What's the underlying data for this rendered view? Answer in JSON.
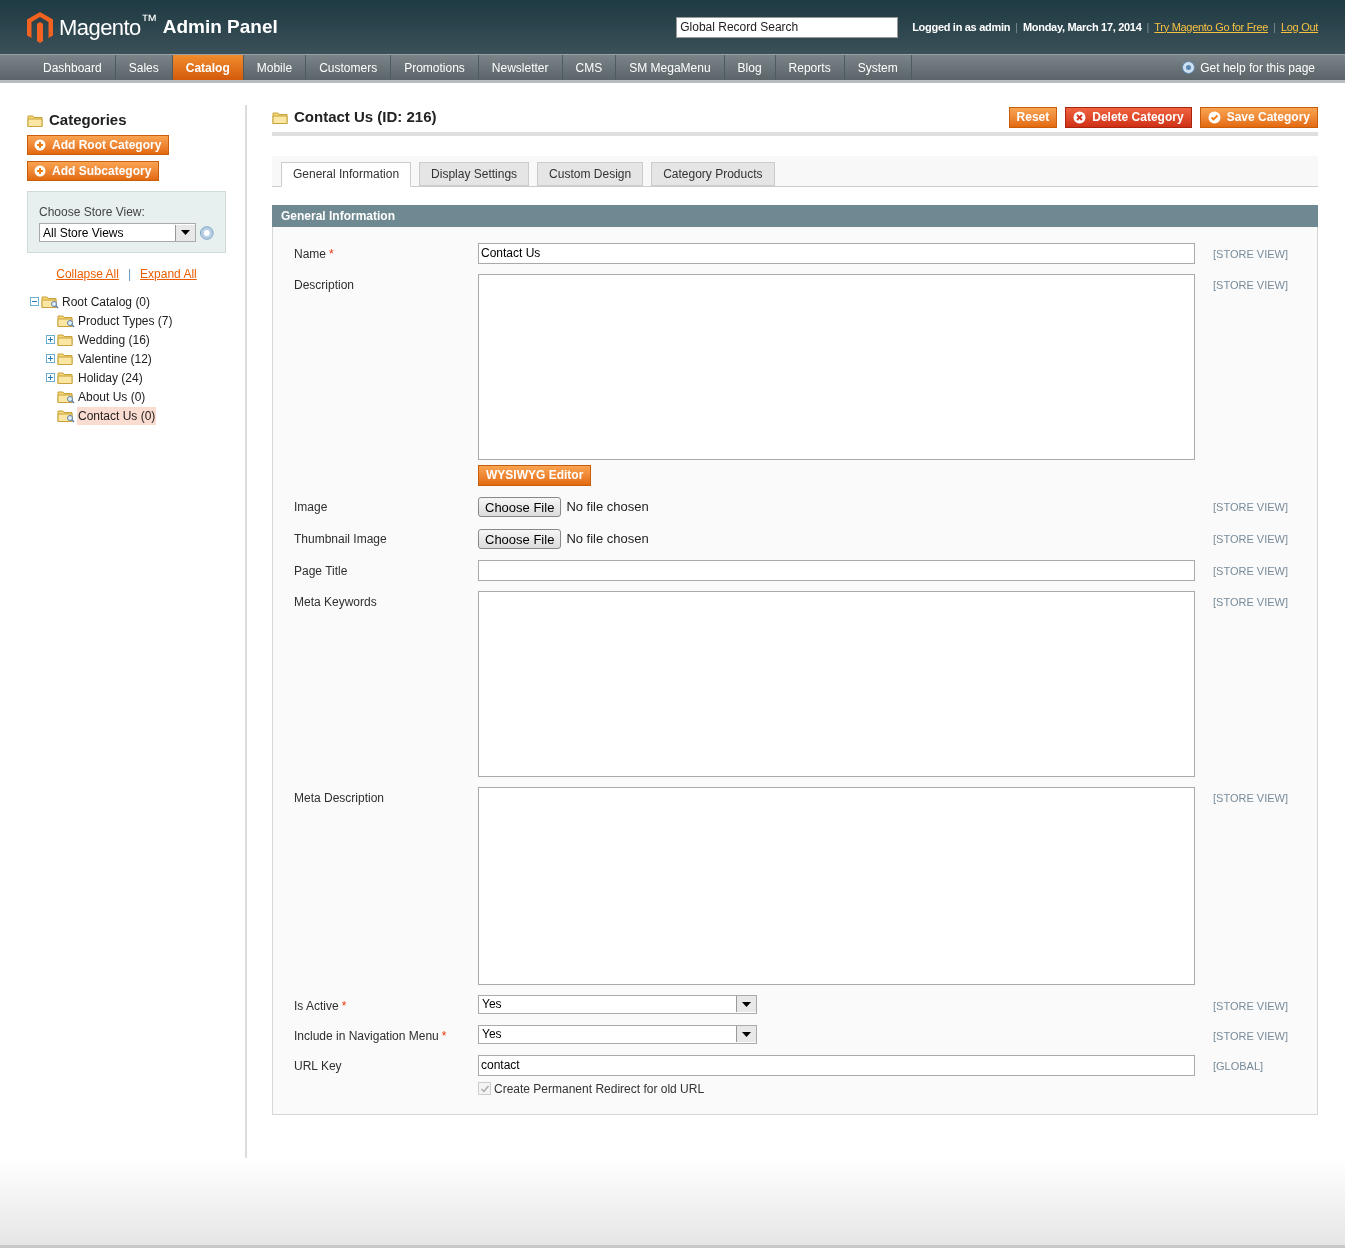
{
  "header": {
    "logo": "Magento$^{™}$",
    "logo_suffix": "Admin Panel",
    "search": {
      "placeholder": "Global Record Search"
    },
    "user": "Logged in as admin",
    "date": "Monday, March 17, 2014",
    "links": [
      "Try Magento Go for Free",
      "Log Out"
    ],
    "separator": "|"
  },
  "nav": {
    "items": [
      {
        "label": "Dashboard",
        "selected": false
      },
      {
        "label": "Sales",
        "selected": false
      },
      {
        "label": "Catalog",
        "selected": true
      },
      {
        "label": "Mobile",
        "selected": false
      },
      {
        "label": "Customers",
        "selected": false
      },
      {
        "label": "Promotions",
        "selected": false
      },
      {
        "label": "Newsletter",
        "selected": false
      },
      {
        "label": "CMS",
        "selected": false
      },
      {
        "label": "SM MegaMenu",
        "selected": false
      },
      {
        "label": "Blog",
        "selected": false
      },
      {
        "label": "Reports",
        "selected": false
      },
      {
        "label": "System",
        "selected": false
      }
    ],
    "help": "Get help for this page"
  },
  "sidebar": {
    "title": "Categories",
    "buttons": [
      "Add Root Category",
      "Add Subcategory"
    ],
    "store_view": {
      "label": "Choose Store View:",
      "value": "All Store Views"
    },
    "collapse": "Collapse All",
    "separator": "|",
    "expand": "Expand All",
    "tree": [
      {
        "label": "Root Catalog (0)",
        "kind": "leaf",
        "expanded": true,
        "selected": false,
        "children": [
          {
            "label": "Product Types (7)",
            "kind": "leaf",
            "expanded": false,
            "selected": false
          },
          {
            "label": "Wedding (16)",
            "kind": "branch",
            "expanded": false,
            "selected": false
          },
          {
            "label": "Valentine (12)",
            "kind": "branch",
            "expanded": false,
            "selected": false
          },
          {
            "label": "Holiday (24)",
            "kind": "branch",
            "expanded": false,
            "selected": false
          },
          {
            "label": "About Us (0)",
            "kind": "leaf",
            "expanded": false,
            "selected": false
          },
          {
            "label": "Contact Us (0)",
            "kind": "leaf",
            "expanded": false,
            "selected": true
          }
        ]
      }
    ]
  },
  "main": {
    "title": "Contact Us (ID: 216)",
    "required_mark": "*",
    "actions": [
      {
        "label": "Reset",
        "kind": "plain"
      },
      {
        "label": "Delete Category",
        "kind": "delete"
      },
      {
        "label": "Save Category",
        "kind": "save"
      }
    ],
    "tabs": [
      {
        "label": "General Information",
        "selected": true
      },
      {
        "label": "Display Settings",
        "selected": false
      },
      {
        "label": "Custom Design",
        "selected": false
      },
      {
        "label": "Category Products",
        "selected": false
      }
    ],
    "section": "General Information",
    "fields": [
      {
        "kind": "text",
        "label": "Name",
        "required": true,
        "value": "Contact Us",
        "scope": "[STORE VIEW]"
      },
      {
        "kind": "textarea",
        "label": "Description",
        "required": false,
        "button": "WYSIWYG Editor",
        "scope": "[STORE VIEW]"
      },
      {
        "kind": "file",
        "label": "Image",
        "required": false,
        "button": "Choose File",
        "status": "No file chosen",
        "scope": "[STORE VIEW]"
      },
      {
        "kind": "file",
        "label": "Thumbnail Image",
        "required": false,
        "button": "Choose File",
        "status": "No file chosen",
        "scope": "[STORE VIEW]"
      },
      {
        "kind": "text",
        "label": "Page Title",
        "required": false,
        "scope": "[STORE VIEW]"
      },
      {
        "kind": "textarea",
        "label": "Meta Keywords",
        "required": false,
        "scope": "[STORE VIEW]"
      },
      {
        "kind": "large_textarea",
        "label": "Meta Description",
        "required": false,
        "scope": "[STORE VIEW]"
      },
      {
        "kind": "select",
        "label": "Is Active",
        "required": true,
        "value": "Yes",
        "scope": "[STORE VIEW]"
      },
      {
        "kind": "select",
        "label": "Include in Navigation Menu",
        "required": true,
        "value": "Yes",
        "scope": "[STORE VIEW]"
      },
      {
        "kind": "text",
        "label": "URL Key",
        "required": false,
        "value": "contact",
        "scope": "[GLOBAL]",
        "checkbox": {
          "label": "Create Permanent Redirect for old URL",
          "checked": true,
          "disabled": true
        }
      }
    ]
  }
}
